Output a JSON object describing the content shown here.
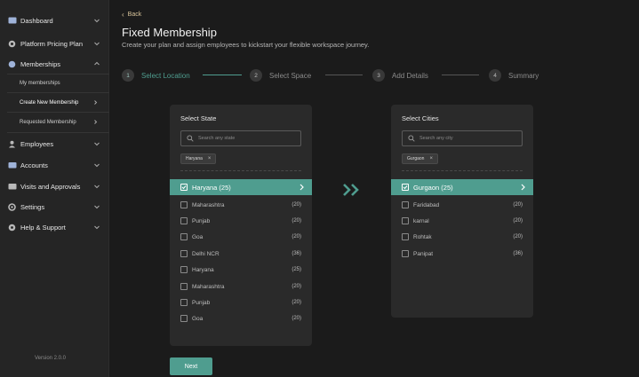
{
  "sidebar": {
    "items": [
      {
        "label": "Dashboard",
        "icon": "dashboard-icon"
      },
      {
        "label": "Platform Pricing Plan",
        "icon": "pricing-icon"
      },
      {
        "label": "Memberships",
        "icon": "membership-icon"
      },
      {
        "label": "Employees",
        "icon": "employees-icon"
      },
      {
        "label": "Accounts",
        "icon": "accounts-icon"
      },
      {
        "label": "Visits and Approvals",
        "icon": "visits-icon"
      },
      {
        "label": "Settings",
        "icon": "settings-icon"
      },
      {
        "label": "Help & Support",
        "icon": "help-icon"
      }
    ],
    "sub_items": [
      {
        "label": "My memberships"
      },
      {
        "label": "Create New Membership"
      },
      {
        "label": "Requested Membership"
      }
    ],
    "version": "Version 2.0.0"
  },
  "header": {
    "back_label": "Back",
    "title": "Fixed Membership",
    "subtitle": "Create your plan and assign employees to kickstart your flexible workspace journey."
  },
  "stepper": {
    "steps": [
      {
        "number": "1",
        "label": "Select Location"
      },
      {
        "number": "2",
        "label": "Select Space"
      },
      {
        "number": "3",
        "label": "Add Details"
      },
      {
        "number": "4",
        "label": "Summary"
      }
    ],
    "active_step": 1
  },
  "state_panel": {
    "title": "Select State",
    "search_placeholder": "Search any state",
    "chip_label": "Haryana",
    "selected": {
      "label": "Haryana (25)"
    },
    "options": [
      {
        "label": "Maharashtra",
        "count": "(20)"
      },
      {
        "label": "Punjab",
        "count": "(20)"
      },
      {
        "label": "Goa",
        "count": "(20)"
      },
      {
        "label": "Delhi NCR",
        "count": "(36)"
      },
      {
        "label": "Haryana",
        "count": "(25)"
      },
      {
        "label": "Maharashtra",
        "count": "(20)"
      },
      {
        "label": "Punjab",
        "count": "(20)"
      },
      {
        "label": "Goa",
        "count": "(20)"
      }
    ]
  },
  "city_panel": {
    "title": "Select Cities",
    "search_placeholder": "Search any city",
    "chip_label": "Gurgaon",
    "selected": {
      "label": "Gurgaon (25)"
    },
    "options": [
      {
        "label": "Faridabad",
        "count": "(20)"
      },
      {
        "label": "karnal",
        "count": "(20)"
      },
      {
        "label": "Rohtak",
        "count": "(20)"
      },
      {
        "label": "Panipat",
        "count": "(36)"
      }
    ]
  },
  "footer": {
    "next_label": "Next"
  },
  "colors": {
    "background": "#1b1b1b",
    "sidebar": "#252525",
    "panel": "#2a2a2a",
    "accent": "#4f9d8f",
    "back_link": "#d7c39a"
  }
}
